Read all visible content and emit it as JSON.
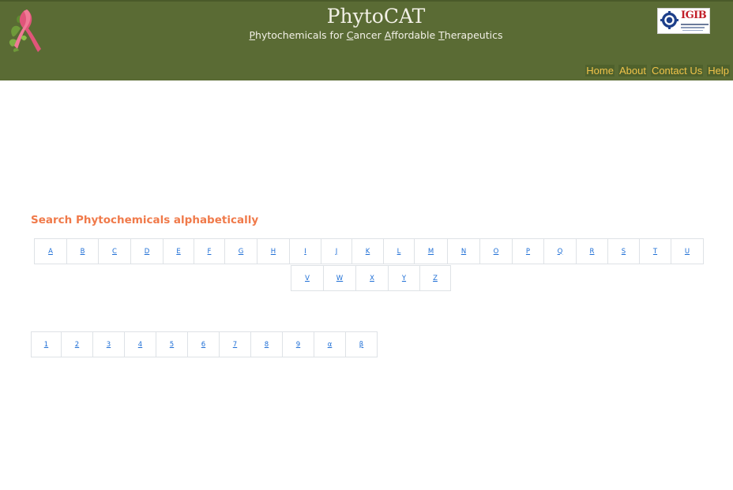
{
  "header": {
    "title": "PhytoCAT",
    "subtitle_parts": [
      {
        "text": "P",
        "u": true
      },
      {
        "text": "hytochemicals for ",
        "u": false
      },
      {
        "text": "C",
        "u": true
      },
      {
        "text": "ancer ",
        "u": false
      },
      {
        "text": "A",
        "u": true
      },
      {
        "text": "ffordable ",
        "u": false
      },
      {
        "text": "T",
        "u": true
      },
      {
        "text": "herapeutics",
        "u": false
      }
    ],
    "logo_text": "IGIB"
  },
  "nav": {
    "items": [
      "Home",
      "About",
      "Contact Us",
      "Help"
    ]
  },
  "search": {
    "heading": "Search Phytochemicals alphabetically"
  },
  "letters_row1": [
    "A",
    "B",
    "C",
    "D",
    "E",
    "F",
    "G",
    "H",
    "I",
    "J",
    "K",
    "L",
    "M",
    "N",
    "O",
    "P",
    "Q",
    "R",
    "S",
    "T",
    "U"
  ],
  "letters_row2": [
    "V",
    "W",
    "X",
    "Y",
    "Z"
  ],
  "symbols_row": [
    "1",
    "2",
    "3",
    "4",
    "5",
    "6",
    "7",
    "8",
    "9",
    "α",
    "β"
  ],
  "colors": {
    "header_bg": "#5a6b34",
    "nav_text": "#f0c34a",
    "heading": "#f07a4a",
    "link": "#1f6fd6"
  }
}
